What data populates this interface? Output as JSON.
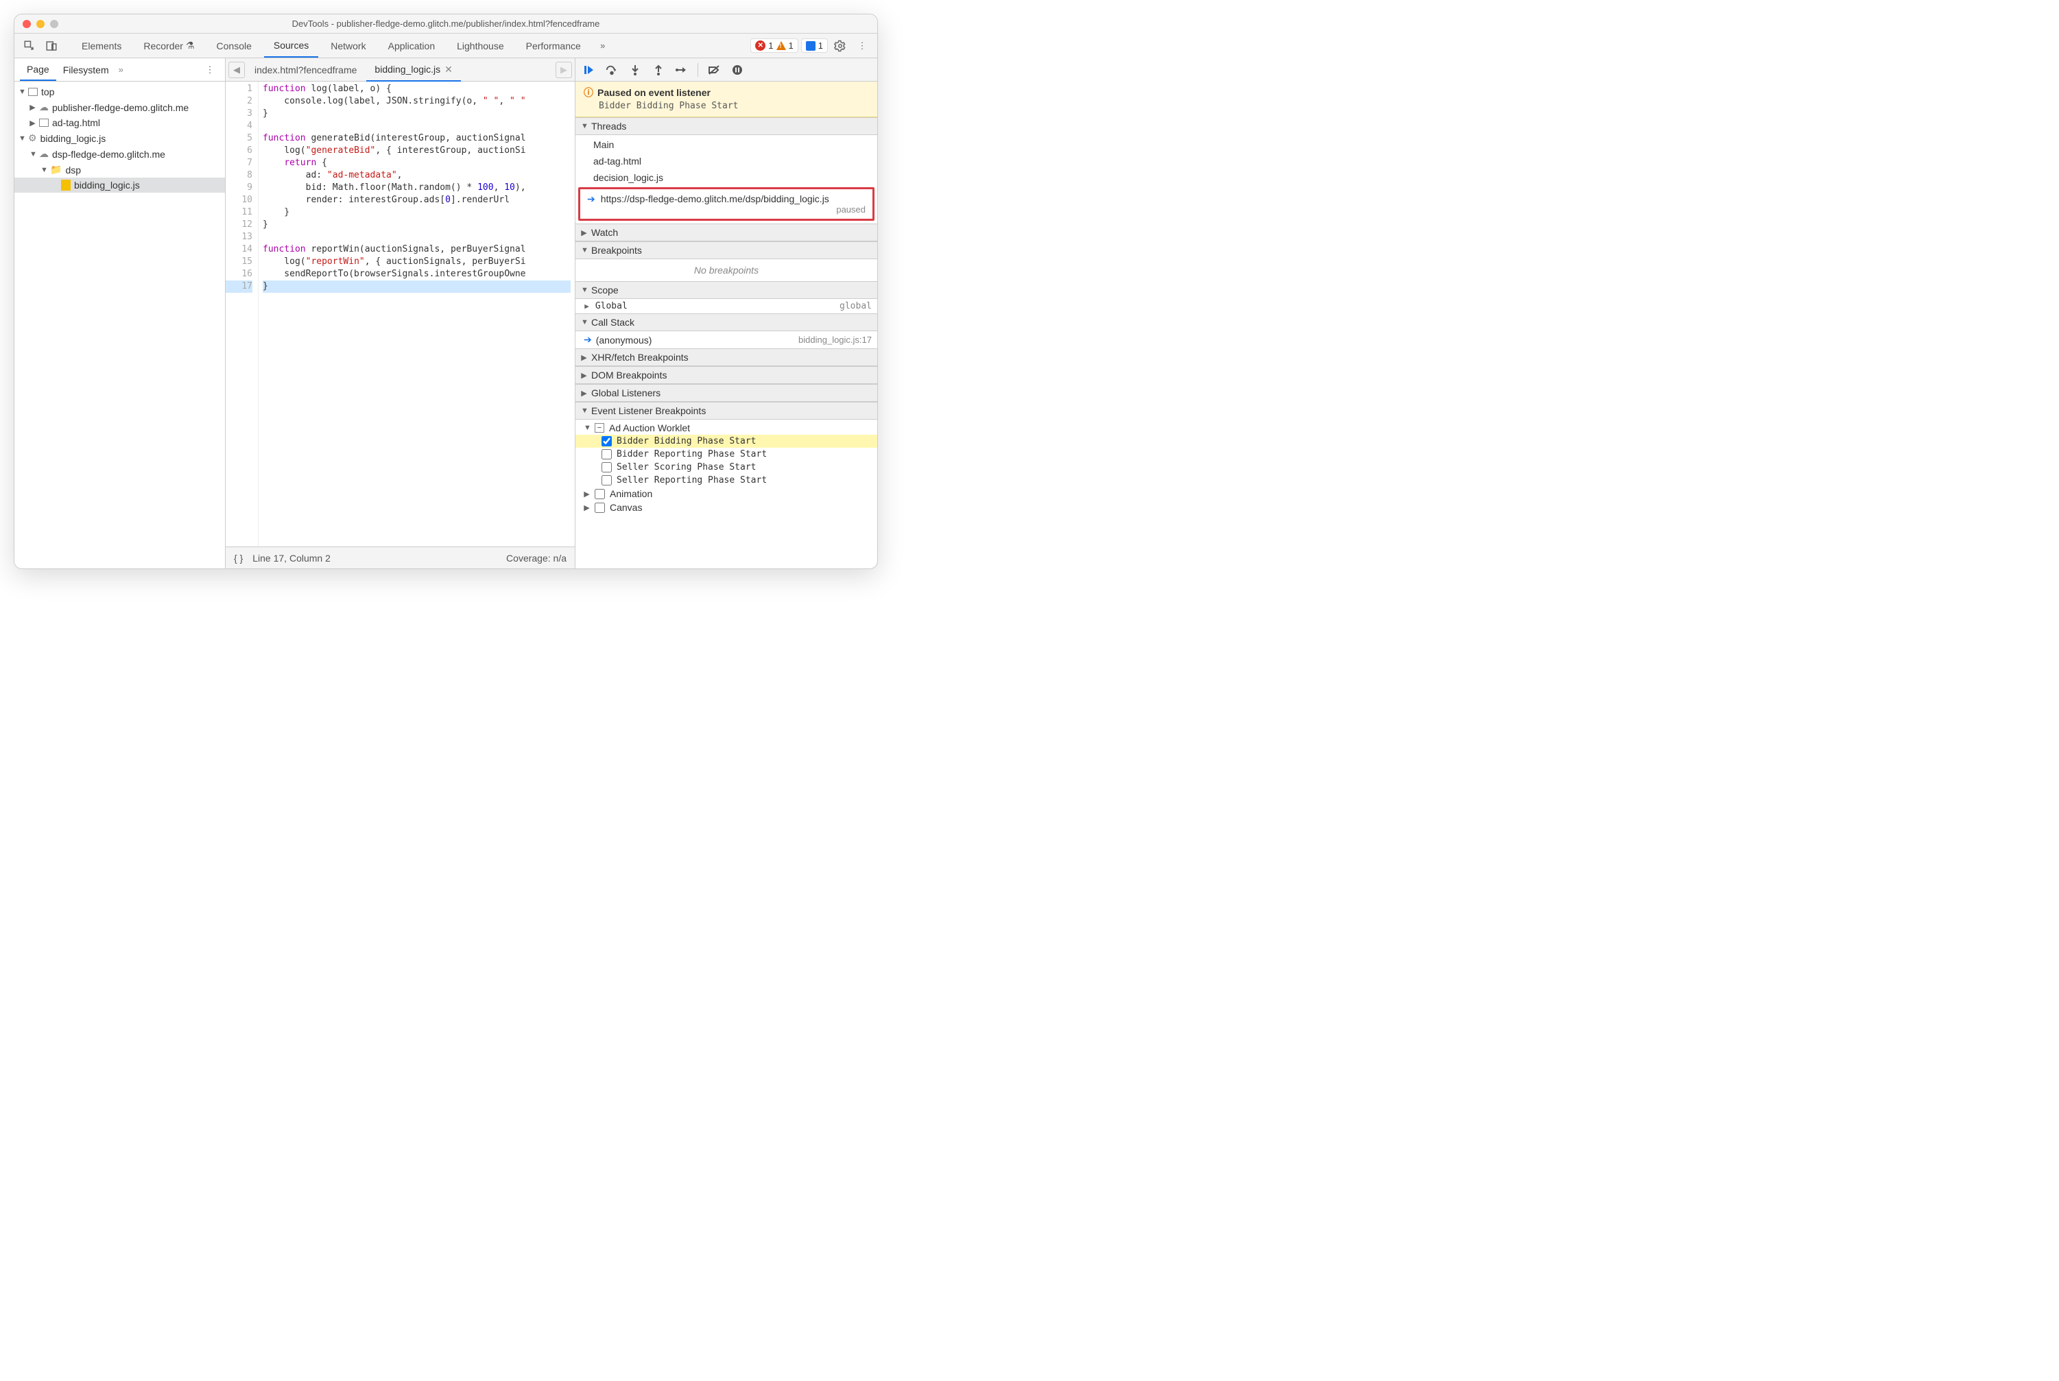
{
  "title": "DevTools - publisher-fledge-demo.glitch.me/publisher/index.html?fencedframe",
  "mainTabs": [
    "Elements",
    "Recorder",
    "Console",
    "Sources",
    "Network",
    "Application",
    "Lighthouse",
    "Performance"
  ],
  "activeMainTab": "Sources",
  "badges": {
    "errors": "1",
    "warnings": "1",
    "issues": "1"
  },
  "navigator": {
    "tabs": [
      "Page",
      "Filesystem"
    ],
    "active": "Page",
    "tree": [
      {
        "label": "top",
        "indent": 0,
        "twisty": "▼",
        "icon": "frame"
      },
      {
        "label": "publisher-fledge-demo.glitch.me",
        "indent": 1,
        "twisty": "▶",
        "icon": "cloud"
      },
      {
        "label": "ad-tag.html",
        "indent": 1,
        "twisty": "▶",
        "icon": "frame"
      },
      {
        "label": "bidding_logic.js",
        "indent": 0,
        "twisty": "▼",
        "icon": "gear"
      },
      {
        "label": "dsp-fledge-demo.glitch.me",
        "indent": 1,
        "twisty": "▼",
        "icon": "cloud"
      },
      {
        "label": "dsp",
        "indent": 2,
        "twisty": "▼",
        "icon": "folder"
      },
      {
        "label": "bidding_logic.js",
        "indent": 3,
        "twisty": "",
        "icon": "js",
        "selected": true
      }
    ]
  },
  "editor": {
    "tabs": [
      {
        "label": "index.html?fencedframe",
        "active": false,
        "closable": false
      },
      {
        "label": "bidding_logic.js",
        "active": true,
        "closable": true
      }
    ],
    "lines": 17,
    "status": {
      "format": "{ }",
      "pos": "Line 17, Column 2",
      "coverage": "Coverage: n/a"
    }
  },
  "codeLines": [
    {
      "n": 1,
      "html": "<span class='kw'>function</span> log(label, o) {"
    },
    {
      "n": 2,
      "html": "    console.log(label, JSON.stringify(o, <span class='str'>\" \"</span>, <span class='str'>\" \"</span>"
    },
    {
      "n": 3,
      "html": "}"
    },
    {
      "n": 4,
      "html": ""
    },
    {
      "n": 5,
      "html": "<span class='kw'>function</span> generateBid(interestGroup, auctionSignal"
    },
    {
      "n": 6,
      "html": "    log(<span class='str'>\"generateBid\"</span>, { interestGroup, auctionSi"
    },
    {
      "n": 7,
      "html": "    <span class='kw'>return</span> {"
    },
    {
      "n": 8,
      "html": "        ad: <span class='str'>\"ad-metadata\"</span>,"
    },
    {
      "n": 9,
      "html": "        bid: Math.floor(Math.random() * <span class='num'>100</span>, <span class='num'>10</span>),"
    },
    {
      "n": 10,
      "html": "        render: interestGroup.ads[<span class='num'>0</span>].renderUrl"
    },
    {
      "n": 11,
      "html": "    }"
    },
    {
      "n": 12,
      "html": "}"
    },
    {
      "n": 13,
      "html": ""
    },
    {
      "n": 14,
      "html": "<span class='kw'>function</span> reportWin(auctionSignals, perBuyerSignal"
    },
    {
      "n": 15,
      "html": "    log(<span class='str'>\"reportWin\"</span>, { auctionSignals, perBuyerSi"
    },
    {
      "n": 16,
      "html": "    sendReportTo(browserSignals.interestGroupOwne"
    },
    {
      "n": 17,
      "html": "}",
      "hl": true
    }
  ],
  "paused": {
    "title": "Paused on event listener",
    "sub": "Bidder Bidding Phase Start"
  },
  "threads": {
    "header": "Threads",
    "items": [
      {
        "label": "Main"
      },
      {
        "label": "ad-tag.html"
      },
      {
        "label": "decision_logic.js"
      },
      {
        "label": "https://dsp-fledge-demo.glitch.me/dsp/bidding_logic.js",
        "highlight": true,
        "status": "paused"
      }
    ]
  },
  "watch": {
    "header": "Watch"
  },
  "breakpoints": {
    "header": "Breakpoints",
    "empty": "No breakpoints"
  },
  "scope": {
    "header": "Scope",
    "rows": [
      {
        "twisty": "▶",
        "name": "Global",
        "scope": "global"
      }
    ]
  },
  "callstack": {
    "header": "Call Stack",
    "rows": [
      {
        "name": "(anonymous)",
        "loc": "bidding_logic.js:17"
      }
    ]
  },
  "xhr": {
    "header": "XHR/fetch Breakpoints"
  },
  "dom": {
    "header": "DOM Breakpoints"
  },
  "global": {
    "header": "Global Listeners"
  },
  "elb": {
    "header": "Event Listener Breakpoints",
    "categories": [
      {
        "label": "Ad Auction Worklet",
        "expanded": true,
        "partial": true,
        "items": [
          {
            "label": "Bidder Bidding Phase Start",
            "checked": true,
            "hl": true
          },
          {
            "label": "Bidder Reporting Phase Start",
            "checked": false
          },
          {
            "label": "Seller Scoring Phase Start",
            "checked": false
          },
          {
            "label": "Seller Reporting Phase Start",
            "checked": false
          }
        ]
      },
      {
        "label": "Animation",
        "expanded": false,
        "partial": false
      },
      {
        "label": "Canvas",
        "expanded": false,
        "partial": false
      }
    ]
  }
}
